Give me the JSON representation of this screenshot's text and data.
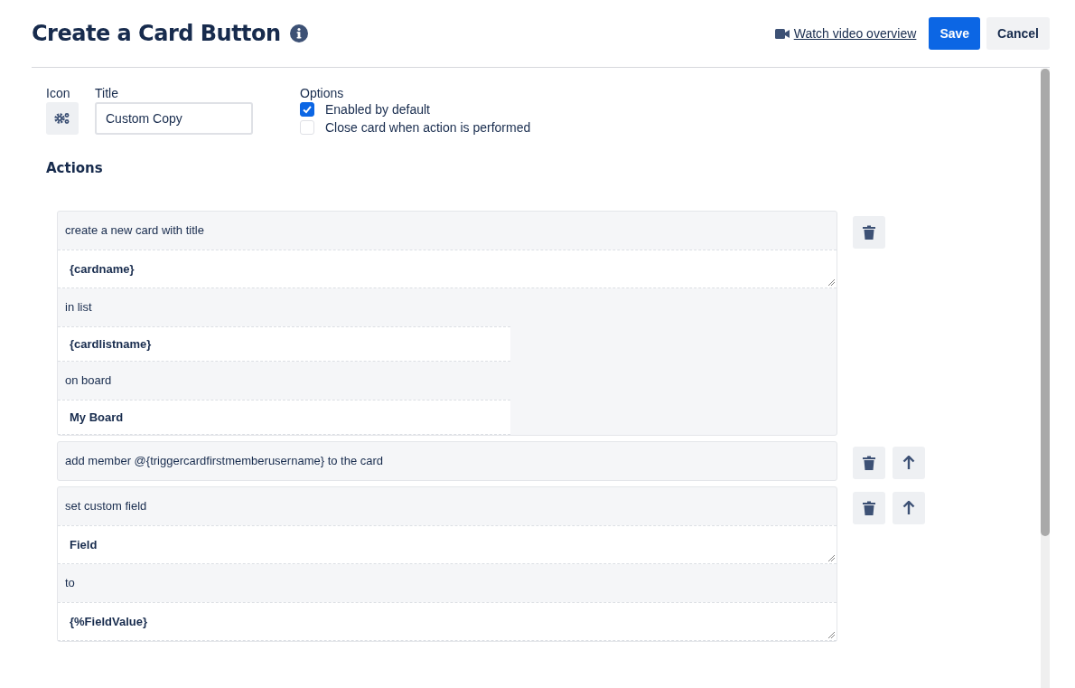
{
  "header": {
    "title": "Create a Card Button",
    "video_link": "Watch video overview",
    "save": "Save",
    "cancel": "Cancel"
  },
  "form": {
    "icon_label": "Icon",
    "title_label": "Title",
    "title_value": "Custom Copy",
    "options_label": "Options",
    "options": [
      {
        "label": "Enabled by default",
        "checked": true
      },
      {
        "label": "Close card when action is performed",
        "checked": false
      }
    ]
  },
  "actions_heading": "Actions",
  "actions": [
    {
      "can_move_up": false,
      "segments": [
        {
          "kind": "text",
          "text": "create a new card with title"
        },
        {
          "kind": "textarea",
          "text": "{cardname}"
        },
        {
          "kind": "text",
          "text": "in list"
        },
        {
          "kind": "input",
          "text": "{cardlistname}"
        },
        {
          "kind": "text",
          "text": "on board"
        },
        {
          "kind": "input",
          "text": "My Board"
        }
      ]
    },
    {
      "can_move_up": true,
      "segments": [
        {
          "kind": "text",
          "text": "add member @{triggercardfirstmemberusername} to the card"
        }
      ]
    },
    {
      "can_move_up": true,
      "segments": [
        {
          "kind": "text",
          "text": "set custom field"
        },
        {
          "kind": "textarea",
          "text": "Field"
        },
        {
          "kind": "text",
          "text": "to"
        },
        {
          "kind": "textarea",
          "text": "{%FieldValue}"
        }
      ]
    }
  ]
}
